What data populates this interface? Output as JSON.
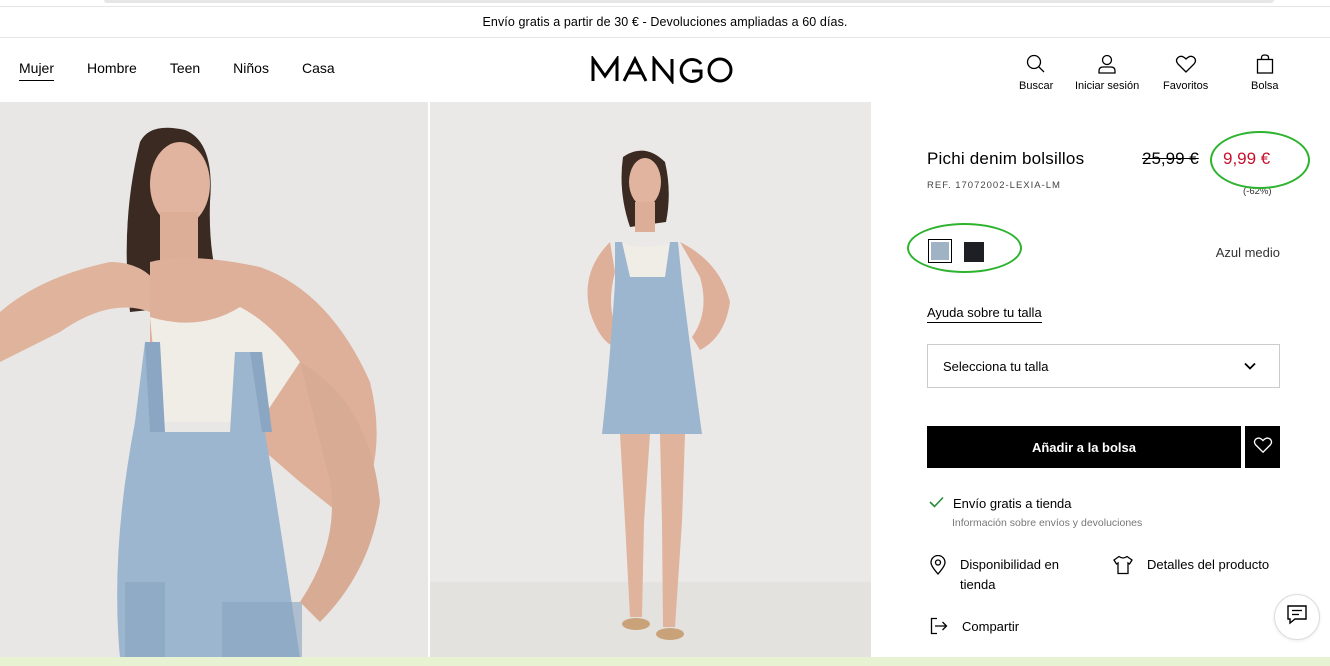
{
  "promo": {
    "text": "Envío gratis a partir de 30 € - Devoluciones ampliadas a 60 días."
  },
  "nav": {
    "items": [
      {
        "label": "Mujer",
        "active": true
      },
      {
        "label": "Hombre"
      },
      {
        "label": "Teen"
      },
      {
        "label": "Niños"
      },
      {
        "label": "Casa"
      }
    ]
  },
  "brand": {
    "logo": "MANGO"
  },
  "actions": {
    "search": "Buscar",
    "login": "Iniciar sesión",
    "favorites": "Favoritos",
    "bag": "Bolsa"
  },
  "product": {
    "title": "Pichi denim bolsillos",
    "ref": "REF. 17072002-LEXIA-LM",
    "old_price": "25,99 €",
    "new_price": "9,99 €",
    "discount": "(-62%)",
    "color_name": "Azul medio",
    "size_help": "Ayuda sobre tu talla",
    "size_select": "Selecciona tu talla",
    "add_to_bag": "Añadir a la bolsa",
    "shipping": "Envío gratis a tienda",
    "shipping_sub": "Información sobre envíos y devoluciones",
    "availability": "Disponibilidad en tienda",
    "details": "Detalles del producto",
    "share": "Compartir"
  },
  "colors": {
    "accent_green": "#2db32d",
    "sale_red": "#c8102e",
    "swatch_blue": "#9fb3c4",
    "swatch_black": "#1d1f24"
  },
  "icons": [
    "search-icon",
    "user-icon",
    "heart-icon",
    "bag-icon",
    "chevron-down-icon",
    "check-icon",
    "location-pin-icon",
    "tshirt-icon",
    "share-icon",
    "chat-icon"
  ]
}
